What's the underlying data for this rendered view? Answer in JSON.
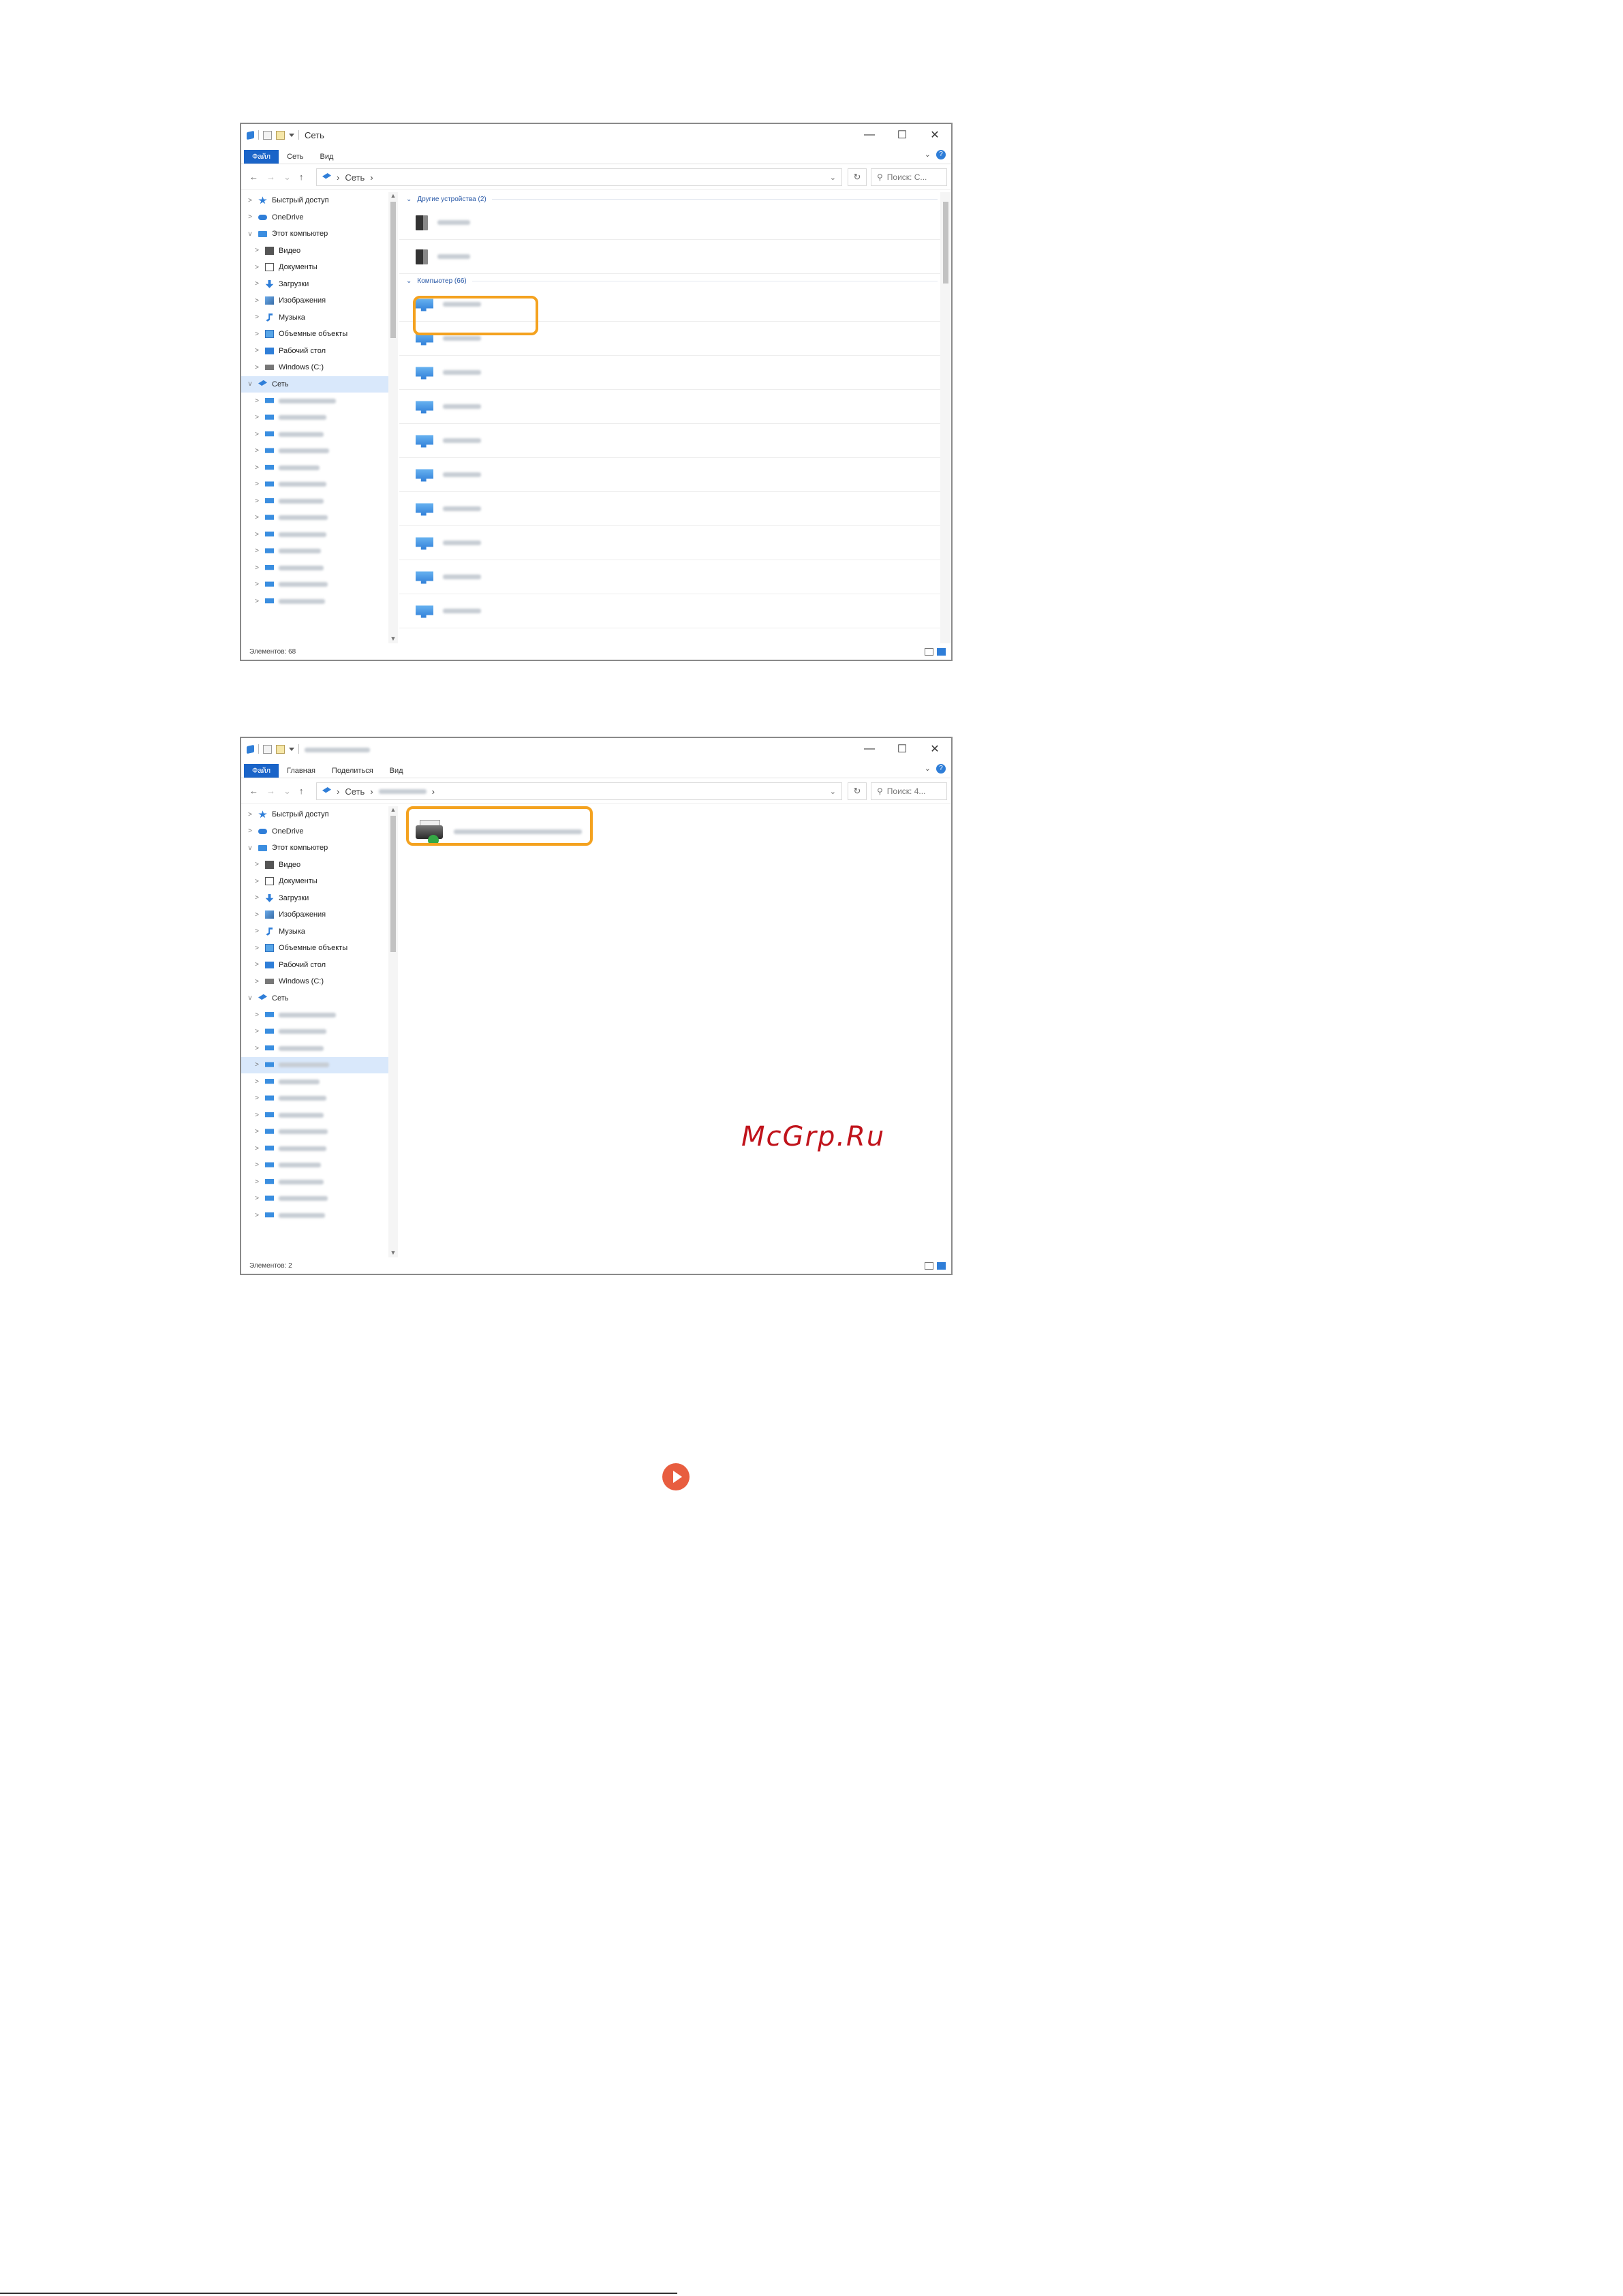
{
  "window1": {
    "title": "Сеть",
    "controls": [
      "—",
      "☐",
      "✕"
    ],
    "ribbon": {
      "tabs": [
        "Файл",
        "Сеть",
        "Вид"
      ],
      "help": "?"
    },
    "address": {
      "path": [
        "Сеть"
      ],
      "search_placeholder": "Поиск: С..."
    },
    "nav": [
      {
        "label": "Быстрый доступ",
        "icon": "star-icon",
        "level": 0,
        "expander": ">"
      },
      {
        "label": "OneDrive",
        "icon": "cloud-icon",
        "level": 0,
        "expander": ">"
      },
      {
        "label": "Этот компьютер",
        "icon": "computer-icon",
        "level": 0,
        "expander": "v"
      },
      {
        "label": "Видео",
        "icon": "video-icon",
        "level": 1,
        "expander": ">"
      },
      {
        "label": "Документы",
        "icon": "document-icon",
        "level": 1,
        "expander": ">"
      },
      {
        "label": "Загрузки",
        "icon": "download-icon",
        "level": 1,
        "expander": ">"
      },
      {
        "label": "Изображения",
        "icon": "image-icon",
        "level": 1,
        "expander": ">"
      },
      {
        "label": "Музыка",
        "icon": "music-icon",
        "level": 1,
        "expander": ">"
      },
      {
        "label": "Объемные объекты",
        "icon": "3d-objects-icon",
        "level": 1,
        "expander": ">"
      },
      {
        "label": "Рабочий стол",
        "icon": "desktop-icon",
        "level": 1,
        "expander": ">"
      },
      {
        "label": "Windows (C:)",
        "icon": "drive-icon",
        "level": 1,
        "expander": ">"
      },
      {
        "label": "Сеть",
        "icon": "network-icon",
        "level": 0,
        "expander": "v",
        "selected": true
      }
    ],
    "nav_hidden_count": 13,
    "groups": [
      {
        "label": "Другие устройства (2)",
        "items_count": 2,
        "kind": "device"
      },
      {
        "label": "Компьютер (66)",
        "items_count": 10,
        "kind": "computer"
      }
    ],
    "status": "Элементов: 68"
  },
  "window2": {
    "title": "",
    "controls": [
      "—",
      "☐",
      "✕"
    ],
    "ribbon": {
      "tabs": [
        "Файл",
        "Главная",
        "Поделиться",
        "Вид"
      ],
      "help": "?"
    },
    "address": {
      "path": [
        "Сеть"
      ],
      "search_placeholder": "Поиск: 4..."
    },
    "nav": [
      {
        "label": "Быстрый доступ",
        "icon": "star-icon",
        "level": 0,
        "expander": ">"
      },
      {
        "label": "OneDrive",
        "icon": "cloud-icon",
        "level": 0,
        "expander": ">"
      },
      {
        "label": "Этот компьютер",
        "icon": "computer-icon",
        "level": 0,
        "expander": "v"
      },
      {
        "label": "Видео",
        "icon": "video-icon",
        "level": 1,
        "expander": ">"
      },
      {
        "label": "Документы",
        "icon": "document-icon",
        "level": 1,
        "expander": ">"
      },
      {
        "label": "Загрузки",
        "icon": "download-icon",
        "level": 1,
        "expander": ">"
      },
      {
        "label": "Изображения",
        "icon": "image-icon",
        "level": 1,
        "expander": ">"
      },
      {
        "label": "Музыка",
        "icon": "music-icon",
        "level": 1,
        "expander": ">"
      },
      {
        "label": "Объемные объекты",
        "icon": "3d-objects-icon",
        "level": 1,
        "expander": ">"
      },
      {
        "label": "Рабочий стол",
        "icon": "desktop-icon",
        "level": 1,
        "expander": ">"
      },
      {
        "label": "Windows (C:)",
        "icon": "drive-icon",
        "level": 1,
        "expander": ">"
      },
      {
        "label": "Сеть",
        "icon": "network-icon",
        "level": 0,
        "expander": "v"
      }
    ],
    "nav_hidden_count": 13,
    "status": "Элементов: 2"
  },
  "watermark": "McGrp.Ru",
  "colors": {
    "highlight": "#f4a21f",
    "watermark": "#c0131b",
    "next_button": "#e85d3f",
    "selected": "#d9e8fb",
    "accent": "#2f7ed8"
  }
}
